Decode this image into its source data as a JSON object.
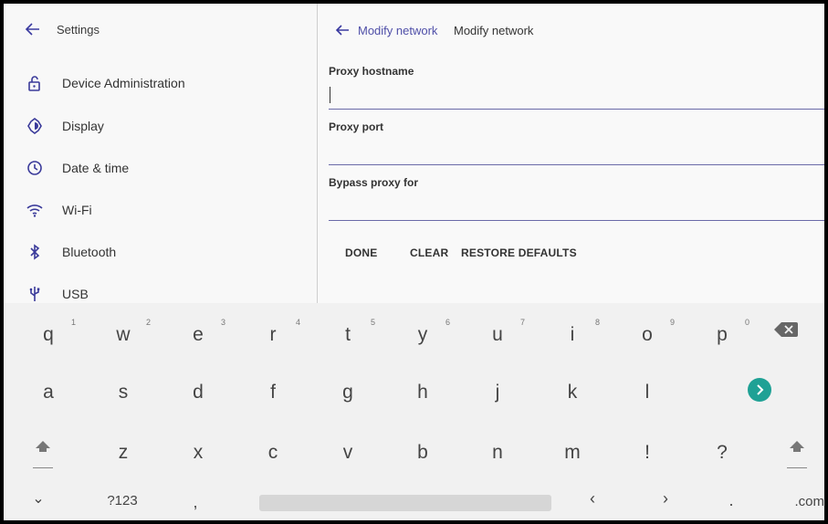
{
  "left_pane": {
    "title": "Settings",
    "items": [
      {
        "label": "Device Administration",
        "icon": "lock-open-icon"
      },
      {
        "label": "Display",
        "icon": "brightness-icon"
      },
      {
        "label": "Date & time",
        "icon": "clock-icon"
      },
      {
        "label": "Wi-Fi",
        "icon": "wifi-icon"
      },
      {
        "label": "Bluetooth",
        "icon": "bluetooth-icon"
      },
      {
        "label": "USB",
        "icon": "usb-icon"
      }
    ]
  },
  "right_pane": {
    "breadcrumb_link": "Modify network",
    "breadcrumb_current": "Modify network",
    "fields": [
      {
        "label": "Proxy hostname",
        "value": ""
      },
      {
        "label": "Proxy port",
        "value": ""
      },
      {
        "label": "Bypass proxy for",
        "value": ""
      }
    ],
    "actions": {
      "done": "DONE",
      "clear": "CLEAR",
      "restore": "RESTORE DEFAULTS"
    }
  },
  "keyboard": {
    "row1": [
      {
        "ch": "q",
        "hint": "1"
      },
      {
        "ch": "w",
        "hint": "2"
      },
      {
        "ch": "e",
        "hint": "3"
      },
      {
        "ch": "r",
        "hint": "4"
      },
      {
        "ch": "t",
        "hint": "5"
      },
      {
        "ch": "y",
        "hint": "6"
      },
      {
        "ch": "u",
        "hint": "7"
      },
      {
        "ch": "i",
        "hint": "8"
      },
      {
        "ch": "o",
        "hint": "9"
      },
      {
        "ch": "p",
        "hint": "0"
      }
    ],
    "row2": [
      "a",
      "s",
      "d",
      "f",
      "g",
      "h",
      "j",
      "k",
      "l"
    ],
    "row3": [
      "z",
      "x",
      "c",
      "v",
      "b",
      "n",
      "m",
      "!",
      "?"
    ],
    "row4": {
      "hide": "⌄",
      "symbols": "?123",
      "comma": ",",
      "left": "‹",
      "right": "›",
      "period": ".",
      "dotcom": ".com"
    },
    "accent_color": "#1fa195"
  }
}
